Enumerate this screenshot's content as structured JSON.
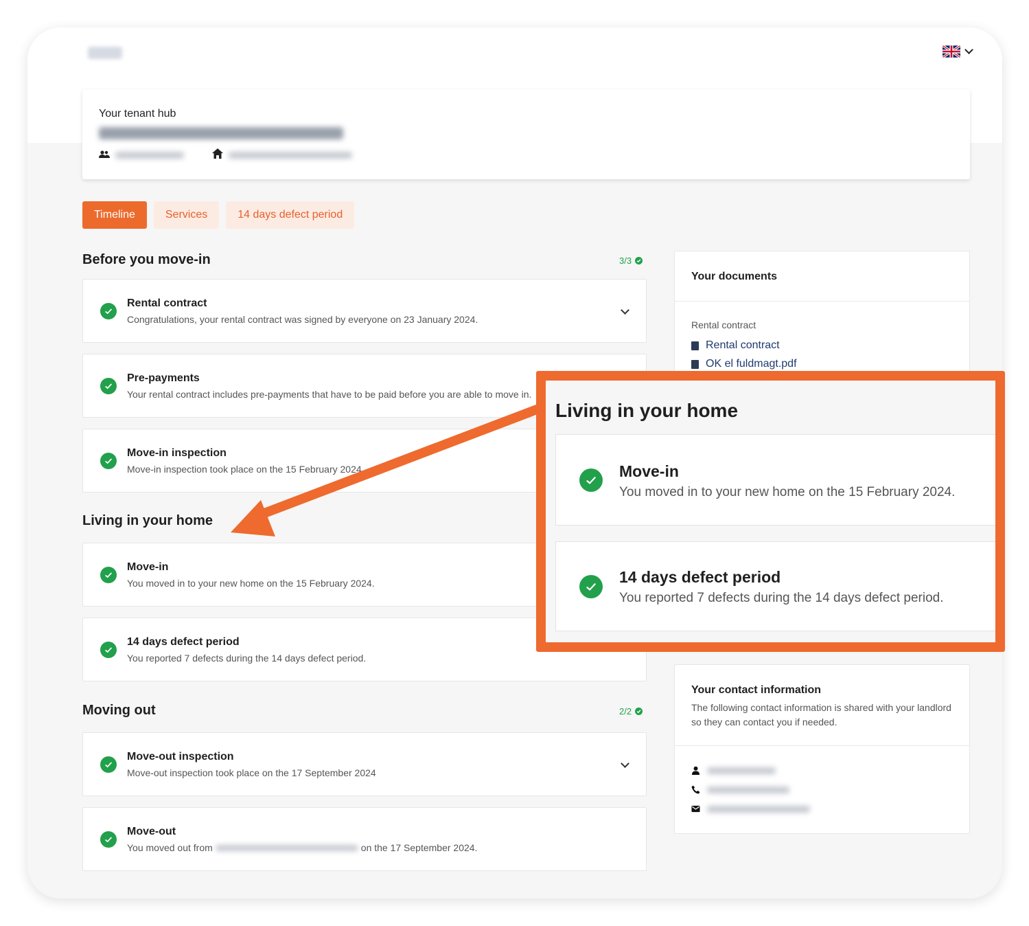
{
  "language": {
    "selected": "English",
    "flag": "uk-flag"
  },
  "hub": {
    "title": "Your tenant hub"
  },
  "tabs": [
    {
      "label": "Timeline",
      "active": true
    },
    {
      "label": "Services",
      "active": false
    },
    {
      "label": "14 days defect period",
      "active": false
    }
  ],
  "before": {
    "title": "Before you move-in",
    "count": "3/3",
    "items": [
      {
        "title": "Rental contract",
        "desc": "Congratulations, your rental contract was signed by everyone on 23 January 2024."
      },
      {
        "title": "Pre-payments",
        "desc": "Your rental contract includes pre-payments that have to be paid before you are able to move in."
      },
      {
        "title": "Move-in inspection",
        "desc": "Move-in inspection took place on the 15 February 2024."
      }
    ]
  },
  "living": {
    "title": "Living in your home",
    "items": [
      {
        "title": "Move-in",
        "desc": "You moved in to your new home on the 15 February 2024."
      },
      {
        "title": "14 days defect period",
        "desc": "You reported 7 defects during the 14 days defect period."
      }
    ]
  },
  "moving_out": {
    "title": "Moving out",
    "count": "2/2",
    "items": [
      {
        "title": "Move-out inspection",
        "desc": "Move-out inspection took place on the 17 September 2024"
      },
      {
        "title": "Move-out",
        "desc_prefix": "You moved out from",
        "desc_suffix": "on the 17 September 2024."
      }
    ]
  },
  "documents": {
    "title": "Your documents",
    "group_label": "Rental contract",
    "links": [
      "Rental contract",
      "OK el fuldmagt.pdf"
    ]
  },
  "contact": {
    "title": "Your contact information",
    "desc": "The following contact information is shared with your landlord so they can contact you if needed."
  },
  "callout": {
    "title": "Living in your home",
    "items": [
      {
        "title": "Move-in",
        "desc": "You moved in to your new home on the 15 February 2024."
      },
      {
        "title": "14 days defect period",
        "desc": "You reported 7 defects during the 14 days defect period."
      }
    ]
  },
  "colors": {
    "accent": "#ed6a2d",
    "success": "#22a04b",
    "link": "#1f3a6e"
  }
}
